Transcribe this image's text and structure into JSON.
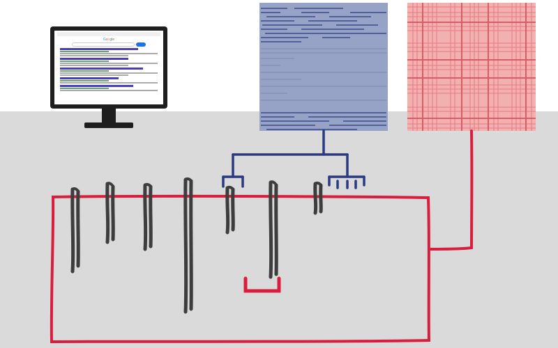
{
  "diagram": {
    "monitor": {
      "logo_chars": [
        "G",
        "o",
        "o",
        "g",
        "l",
        "e"
      ]
    },
    "tiles": {
      "dense": {
        "color": "#2b3a80"
      },
      "sparse": {
        "color": "#d94e5a"
      }
    },
    "connectors": {
      "dense_to_bars": {
        "color": "#2b3a80"
      },
      "sparse_to_box": {
        "color": "#d81e3c"
      }
    },
    "red_box": {
      "color": "#d81e3c"
    },
    "red_bracket": {
      "color": "#d81e3c"
    },
    "bars": {
      "color": "#3d3d3d"
    }
  }
}
